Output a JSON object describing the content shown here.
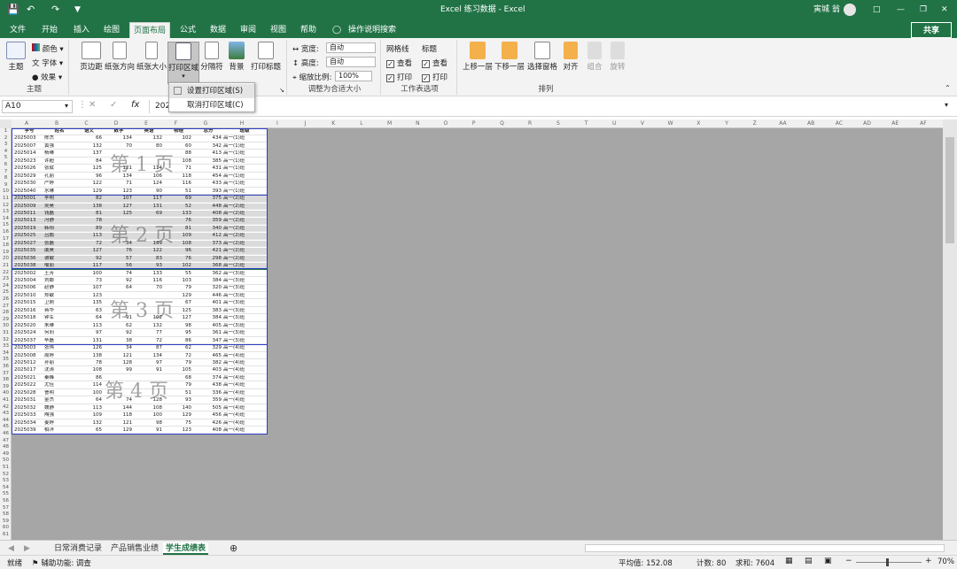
{
  "app": {
    "title": "Excel 练习数据  -  Excel",
    "user": "寅城 翁",
    "share": "共享"
  },
  "tabs": [
    "文件",
    "开始",
    "插入",
    "绘图",
    "页面布局",
    "公式",
    "数据",
    "审阅",
    "视图",
    "帮助",
    "操作说明搜索"
  ],
  "ribbon": {
    "theme": {
      "theme_btn": "主题",
      "colors": "颜色",
      "fonts": "字体",
      "effects": "效果",
      "label": "主题"
    },
    "page_setup": {
      "margins": "页边距",
      "orientation": "纸张方向",
      "size": "纸张大小",
      "print_area": "打印区域",
      "breaks": "分隔符",
      "background": "背景",
      "print_titles": "打印标题",
      "label": "页"
    },
    "scale": {
      "width_label": "宽度:",
      "width_value": "自动",
      "height_label": "高度:",
      "height_value": "自动",
      "scale_label": "缩放比例:",
      "scale_value": "100%",
      "label": "调整为合适大小"
    },
    "sheet_options": {
      "gridlines": "网格线",
      "headings": "标题",
      "view1": "查看",
      "print1": "打印",
      "view2": "查看",
      "print2": "打印",
      "label": "工作表选项"
    },
    "arrange": {
      "bring_forward": "上移一层",
      "send_backward": "下移一层",
      "selection_pane": "选择窗格",
      "align": "对齐",
      "group": "组合",
      "rotate": "旋转",
      "label": "排列"
    }
  },
  "menu": {
    "set_print_area": "设置打印区域(S)",
    "clear_print_area": "取消打印区域(C)"
  },
  "formula": {
    "name_box": "A10",
    "content": "202",
    "fx": "fx"
  },
  "columns": [
    "A",
    "B",
    "C",
    "D",
    "E",
    "F",
    "G",
    "H",
    "I",
    "J",
    "K",
    "L",
    "M",
    "N",
    "O",
    "P",
    "Q",
    "R",
    "S",
    "T",
    "U",
    "V",
    "W",
    "X",
    "Y",
    "Z",
    "AA",
    "AB",
    "AC",
    "AD",
    "AE",
    "AF",
    "AG"
  ],
  "headers": [
    "学号",
    "姓名",
    "语文",
    "数学",
    "英语",
    "物理",
    "总分",
    "班级"
  ],
  "rows": [
    [
      "2025003",
      "陈杰",
      "66",
      "134",
      "132",
      "102",
      "434",
      "高一(1)班"
    ],
    [
      "2025007",
      "黄强",
      "132",
      "70",
      "80",
      "60",
      "342",
      "高一(1)班"
    ],
    [
      "2025014",
      "杨琳",
      "137",
      "",
      "",
      "88",
      "413",
      "高一(1)班"
    ],
    [
      "2025023",
      "许超",
      "84",
      "",
      "",
      "108",
      "385",
      "高一(1)班"
    ],
    [
      "2025026",
      "张斌",
      "125",
      "121",
      "114",
      "71",
      "431",
      "高一(1)班"
    ],
    [
      "2025029",
      "孔丽",
      "96",
      "134",
      "106",
      "118",
      "454",
      "高一(1)班"
    ],
    [
      "2025030",
      "严婷",
      "122",
      "71",
      "124",
      "116",
      "433",
      "高一(1)班"
    ],
    [
      "2025040",
      "水琳",
      "129",
      "123",
      "90",
      "51",
      "393",
      "高一(1)班"
    ],
    [
      "2025001",
      "李明",
      "82",
      "107",
      "117",
      "69",
      "375",
      "高一(2)班"
    ],
    [
      "2025009",
      "吴昊",
      "138",
      "127",
      "131",
      "52",
      "448",
      "高一(2)班"
    ],
    [
      "2025011",
      "钱磊",
      "81",
      "125",
      "69",
      "133",
      "408",
      "高一(2)班"
    ],
    [
      "2025013",
      "冯静",
      "78",
      "",
      "",
      "76",
      "359",
      "高一(2)班"
    ],
    [
      "2025019",
      "韩阳",
      "89",
      "",
      "",
      "81",
      "340",
      "高一(2)班"
    ],
    [
      "2025025",
      "吕鹏",
      "113",
      "",
      "",
      "109",
      "412",
      "高一(2)班"
    ],
    [
      "2025027",
      "张磊",
      "72",
      "34",
      "139",
      "108",
      "373",
      "高一(2)班"
    ],
    [
      "2025035",
      "戚昊",
      "127",
      "76",
      "122",
      "96",
      "421",
      "高一(2)班"
    ],
    [
      "2025036",
      "谢敏",
      "92",
      "57",
      "83",
      "76",
      "298",
      "高一(2)班"
    ],
    [
      "2025038",
      "喻丽",
      "117",
      "56",
      "93",
      "102",
      "368",
      "高一(2)班"
    ],
    [
      "2025002",
      "王芳",
      "100",
      "74",
      "133",
      "55",
      "362",
      "高一(3)班"
    ],
    [
      "2025004",
      "刘娜",
      "73",
      "92",
      "116",
      "103",
      "384",
      "高一(3)班"
    ],
    [
      "2025006",
      "赵静",
      "107",
      "64",
      "70",
      "79",
      "320",
      "高一(3)班"
    ],
    [
      "2025010",
      "郑敏",
      "123",
      "",
      "",
      "129",
      "446",
      "高一(3)班"
    ],
    [
      "2025015",
      "卫刚",
      "135",
      "",
      "",
      "67",
      "401",
      "高一(3)班"
    ],
    [
      "2025016",
      "蒋华",
      "63",
      "",
      "",
      "125",
      "383",
      "高一(3)班"
    ],
    [
      "2025018",
      "钟军",
      "64",
      "91",
      "102",
      "127",
      "384",
      "高一(3)班"
    ],
    [
      "2025020",
      "朱琳",
      "113",
      "62",
      "132",
      "98",
      "405",
      "高一(3)班"
    ],
    [
      "2025024",
      "何莉",
      "97",
      "92",
      "77",
      "95",
      "361",
      "高一(3)班"
    ],
    [
      "2025037",
      "毕磊",
      "131",
      "38",
      "72",
      "86",
      "347",
      "高一(3)班"
    ],
    [
      "2025003",
      "张伟",
      "126",
      "34",
      "87",
      "62",
      "329",
      "高一(4)班"
    ],
    [
      "2025008",
      "周婷",
      "138",
      "121",
      "134",
      "72",
      "465",
      "高一(4)班"
    ],
    [
      "2025012",
      "孙丽",
      "78",
      "128",
      "97",
      "79",
      "382",
      "高一(4)班"
    ],
    [
      "2025017",
      "沈涛",
      "108",
      "99",
      "91",
      "105",
      "403",
      "高一(4)班"
    ],
    [
      "2025021",
      "秦峰",
      "86",
      "",
      "",
      "68",
      "374",
      "高一(4)班"
    ],
    [
      "2025022",
      "尤佳",
      "114",
      "",
      "",
      "79",
      "438",
      "高一(4)班"
    ],
    [
      "2025028",
      "曹明",
      "100",
      "",
      "",
      "51",
      "336",
      "高一(4)班"
    ],
    [
      "2025031",
      "金杰",
      "64",
      "74",
      "128",
      "93",
      "359",
      "高一(4)班"
    ],
    [
      "2025032",
      "魏静",
      "113",
      "144",
      "108",
      "140",
      "505",
      "高一(4)班"
    ],
    [
      "2025033",
      "陶强",
      "109",
      "118",
      "100",
      "129",
      "456",
      "高一(4)班"
    ],
    [
      "2025034",
      "姜婷",
      "132",
      "121",
      "98",
      "75",
      "426",
      "高一(4)班"
    ],
    [
      "2025039",
      "柏洋",
      "65",
      "129",
      "91",
      "123",
      "408",
      "高一(4)班"
    ]
  ],
  "pages": [
    "第 1 页",
    "第 2 页",
    "第 3 页",
    "第 4 页"
  ],
  "sheets": [
    "日常消费记录",
    "产品销售业绩",
    "学生成绩表"
  ],
  "status": {
    "ready": "就绪",
    "accessibility": "辅助功能: 调查",
    "average": "平均值: 152.08",
    "count": "计数: 80",
    "sum": "求和: 7604",
    "zoom": "70%"
  }
}
